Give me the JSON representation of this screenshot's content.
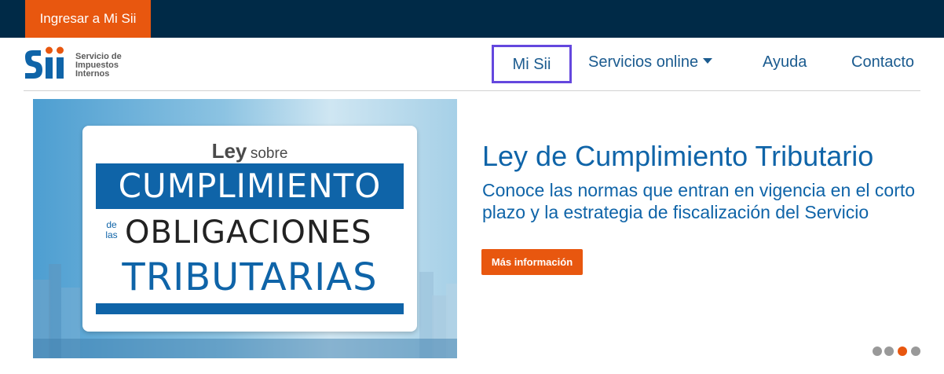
{
  "topbar": {
    "login_label": "Ingresar a Mi Sii"
  },
  "logo": {
    "line1": "Servicio de",
    "line2": "Impuestos",
    "line3": "Internos",
    "mark_text": "Sii"
  },
  "nav": {
    "items": [
      {
        "label": "Mi Sii"
      },
      {
        "label": "Servicios online"
      },
      {
        "label": "Ayuda"
      },
      {
        "label": "Contacto"
      }
    ]
  },
  "banner": {
    "ley": "Ley",
    "sobre": "sobre",
    "line1": "CUMPLIMIENTO",
    "de": "de",
    "las": "las",
    "line2": "OBLIGACIONES",
    "line3": "TRIBUTARIAS"
  },
  "hero": {
    "title": "Ley de Cumplimiento Tributario",
    "description": "Conoce las normas que entran en vigencia en el corto plazo y la estrategia de fiscalización del Servicio",
    "button_label": "Más información"
  },
  "carousel": {
    "count": 4,
    "active_index": 2
  },
  "colors": {
    "topbar": "#002a47",
    "accent": "#e8570f",
    "brand_blue": "#0f64a8",
    "nav_text": "#1b5b8f",
    "focus_outline": "#6447de"
  }
}
